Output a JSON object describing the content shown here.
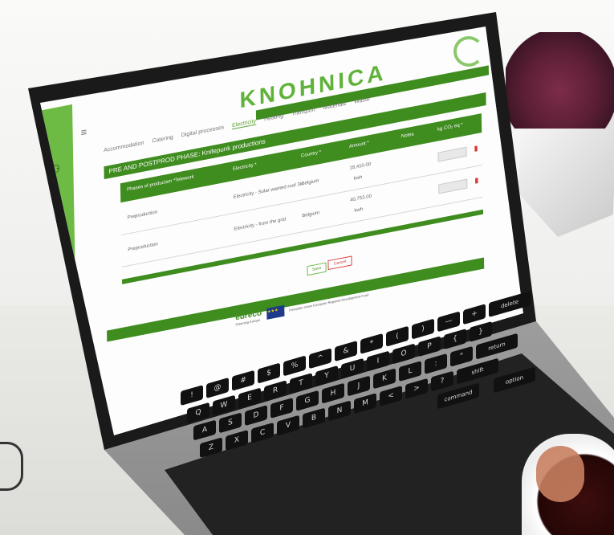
{
  "app": {
    "brand_text": "KNOHNICA",
    "sidebar_icons": [
      "network-icon",
      "database-icon",
      "globe-icon",
      "gear-icon",
      "trash-icon",
      "user-icon"
    ],
    "tabs": [
      "Accommodation",
      "Catering",
      "Digital processes",
      "Electricity",
      "Heating",
      "Transport",
      "Materials",
      "Waste"
    ],
    "active_tab": "Electricity",
    "section_title": "PRE AND POSTPROD PHASE: Knifepunk productions",
    "table_headers": [
      "Phases of production *",
      "Telework",
      "Electricity *",
      "Country *",
      "Amount *",
      "Notes",
      "kg CO₂ eq *"
    ],
    "rows": [
      {
        "phase": "Preproduction",
        "electricity": "Electricity - Solar wanted roof 3k",
        "country": "Belgium",
        "amount": "18,410.00",
        "unit": "kwh"
      },
      {
        "phase": "Preproduction",
        "electricity": "Electricity - from the grid",
        "country": "Belgium",
        "amount": "40,753.00",
        "unit": "kwh"
      }
    ],
    "buttons": {
      "save": "Save",
      "cancel": "Cancel"
    },
    "footer": {
      "eureco": "eureco",
      "eureco_sub": "Greening Europe",
      "eu_caption": "European Union European Regional Development Fund"
    }
  },
  "colors": {
    "brand_green": "#6dbb45",
    "dark_green": "#3f8c1f",
    "danger": "#d33"
  },
  "keyboard": {
    "row1": [
      "!",
      "@",
      "#",
      "$",
      "%",
      "^",
      "&",
      "*",
      "(",
      ")",
      "—",
      "+",
      "delete"
    ],
    "row2": [
      "Q",
      "W",
      "E",
      "R",
      "T",
      "Y",
      "U",
      "I",
      "O",
      "P",
      "{",
      "}"
    ],
    "row3": [
      "A",
      "S",
      "D",
      "F",
      "G",
      "H",
      "J",
      "K",
      "L",
      ":",
      "\"",
      "return"
    ],
    "row4": [
      "Z",
      "X",
      "C",
      "V",
      "B",
      "N",
      "M",
      "<",
      ">",
      "?",
      "shift"
    ],
    "row5": [
      "command",
      "option"
    ]
  }
}
